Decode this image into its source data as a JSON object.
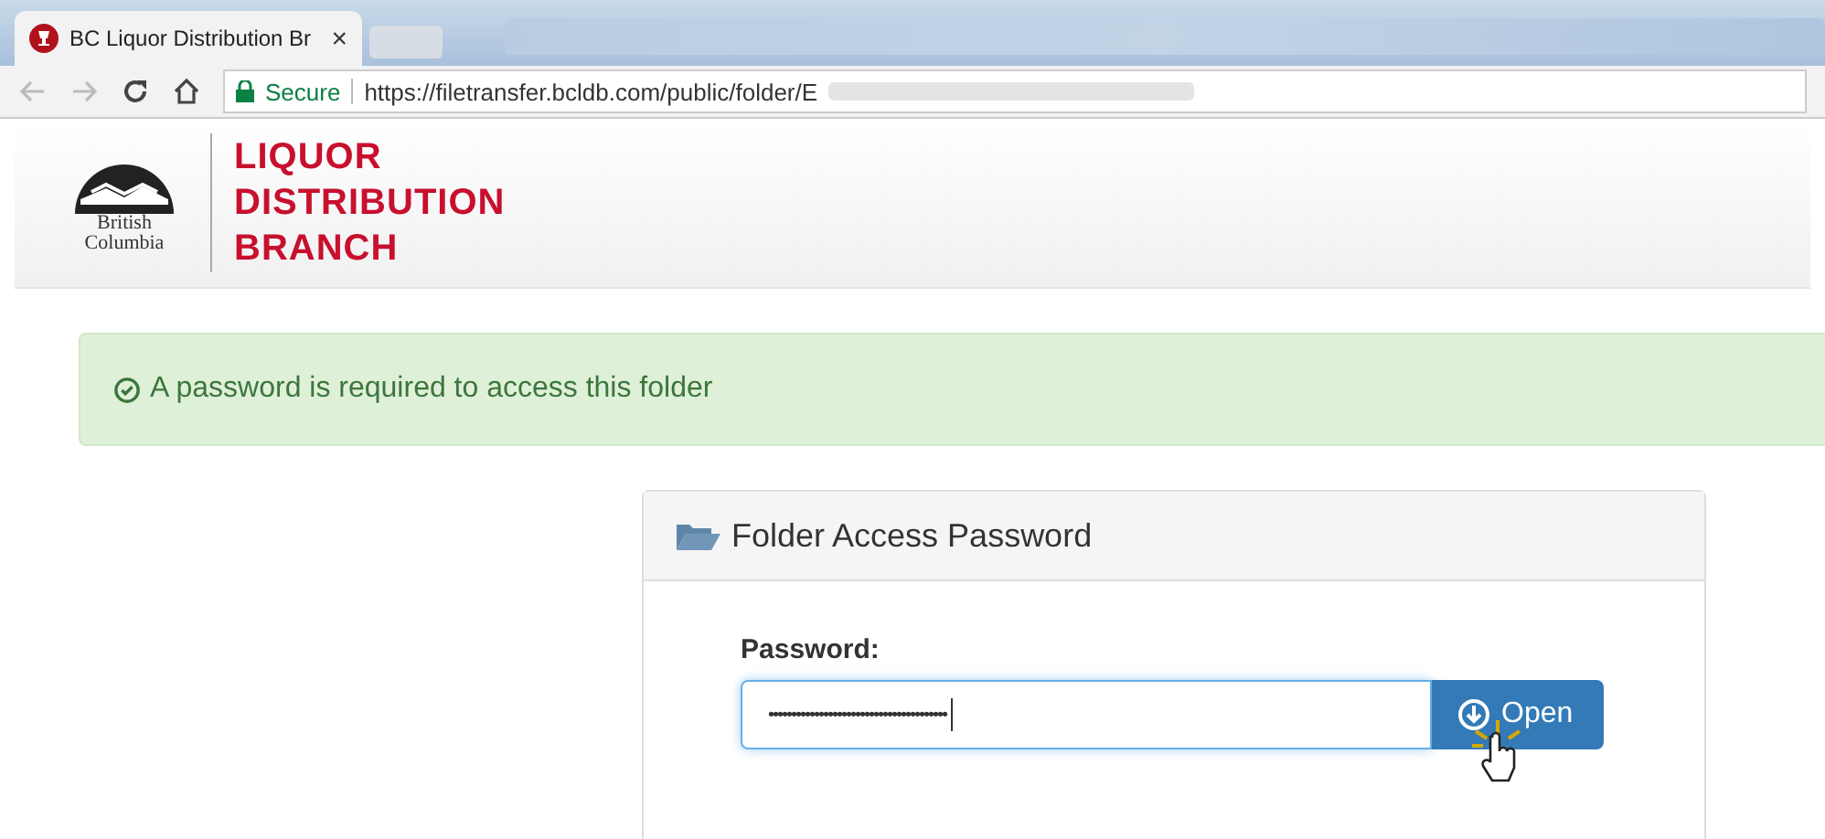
{
  "browser": {
    "tab": {
      "title": "BC Liquor Distribution Br",
      "close": "×"
    },
    "address": {
      "secure_label": "Secure",
      "url": "https://filetransfer.bcldb.com/public/folder/E"
    }
  },
  "header": {
    "logo_lines": [
      "British",
      "Columbia"
    ],
    "title_lines": [
      "LIQUOR",
      "DISTRIBUTION",
      "BRANCH"
    ]
  },
  "alert": {
    "message": "A password is required to access this folder"
  },
  "panel": {
    "title": "Folder Access Password",
    "field_label": "Password:",
    "field_value": "•••••••••••••••••••••••••••••••••••••••",
    "button": "Open"
  }
}
